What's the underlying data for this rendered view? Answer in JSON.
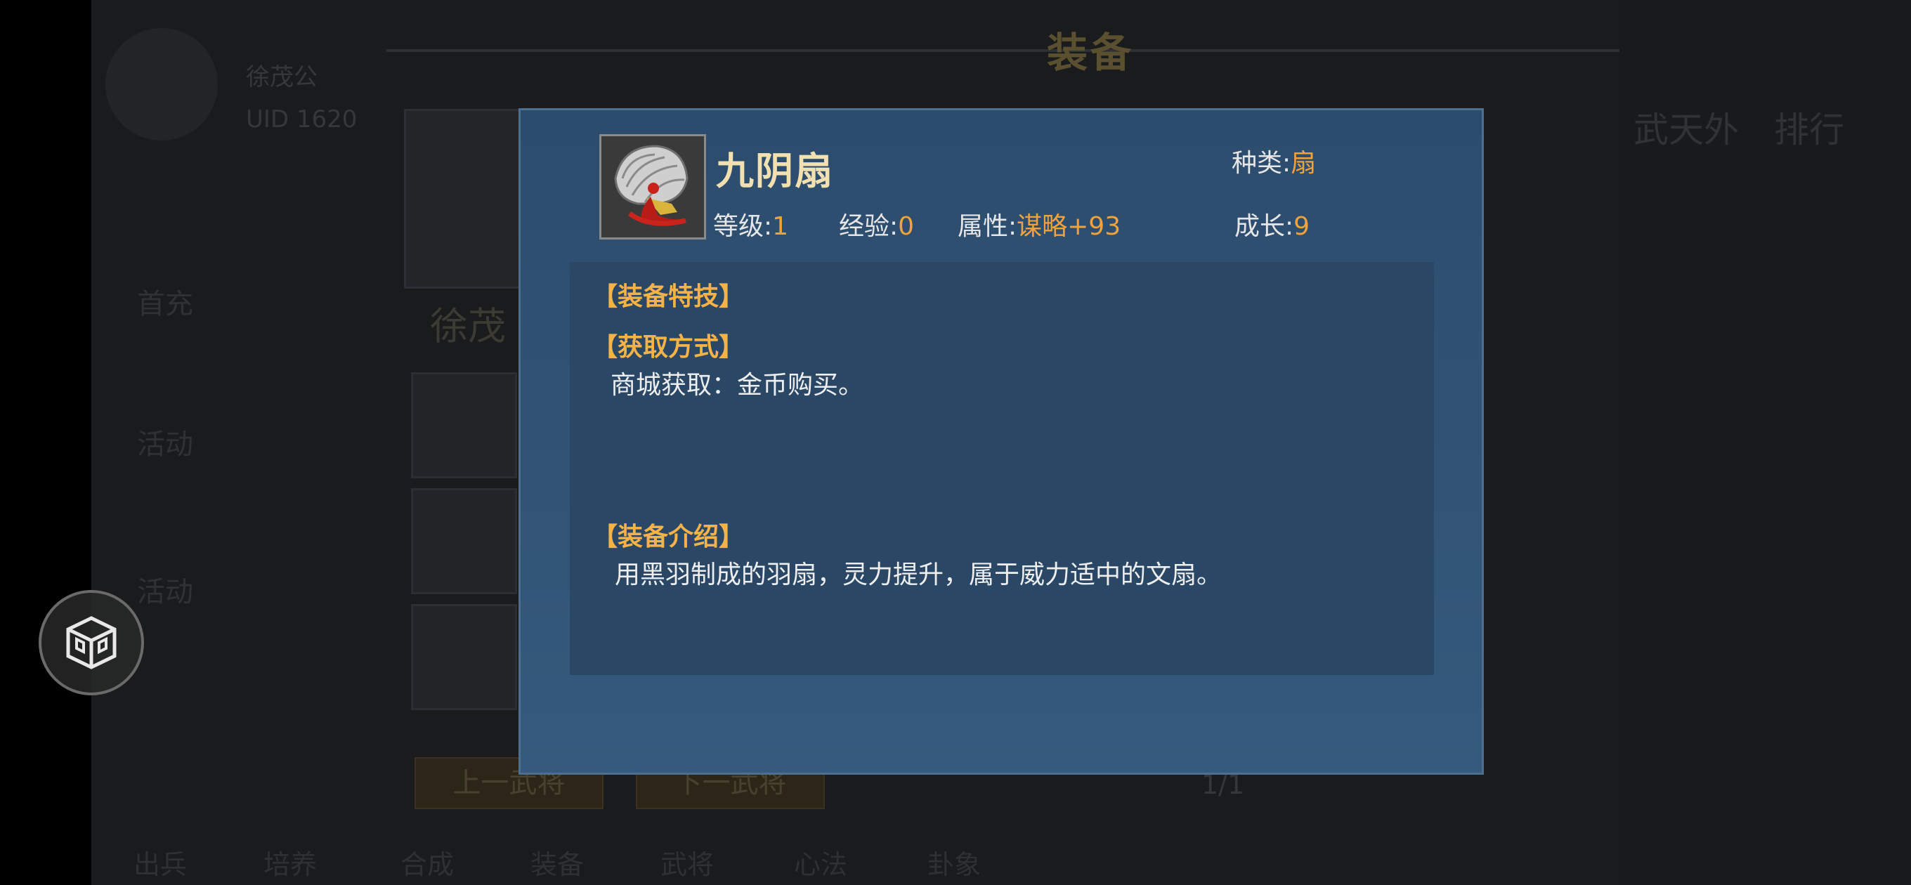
{
  "background": {
    "screen_title": "装备",
    "player_name": "徐茂公",
    "uid_label": "UID 1620",
    "hero_name": "徐茂",
    "side_menu": [
      "首充",
      "活动",
      "活动"
    ],
    "prev_button": "上一武将",
    "next_button": "下一武将",
    "pager": "1/1",
    "right_tabs": [
      "武天外",
      "排行"
    ],
    "bottom_tabs": [
      "出兵",
      "培养",
      "合成",
      "装备",
      "武将",
      "心法",
      "卦象"
    ]
  },
  "item": {
    "name": "九阴扇",
    "type_label": "种类:",
    "type_value": "扇",
    "level_label": "等级:",
    "level_value": "1",
    "exp_label": "经验:",
    "exp_value": "0",
    "attr_label": "属性:",
    "attr_value": "谋略+93",
    "growth_label": "成长:",
    "growth_value": "9"
  },
  "sections": {
    "skill_title": "【装备特技】",
    "obtain_title": "【获取方式】",
    "obtain_text": "商城获取：金币购买。",
    "intro_title": "【装备介绍】",
    "intro_text": "用黑羽制成的羽扇，灵力提升，属于威力适中的文扇。"
  },
  "icons": {
    "item": "fan-icon",
    "float": "assistive-menu-icon",
    "close": "close-icon"
  },
  "colors": {
    "dialog_bg": "#355a7d",
    "value_orange": "#f0a23c",
    "section_title": "#f5b347",
    "item_name": "#f2e0b0"
  }
}
